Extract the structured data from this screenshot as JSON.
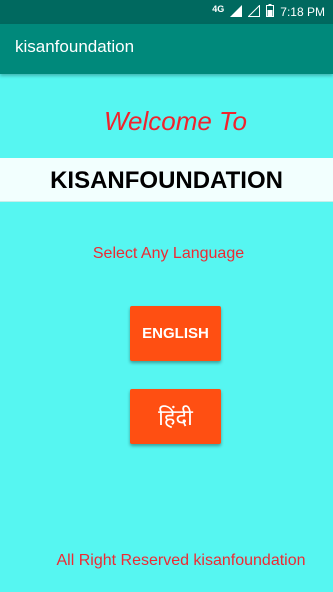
{
  "status_bar": {
    "network": "4G",
    "time": "7:18 PM",
    "icons": [
      "signal-icon",
      "signal-empty-icon",
      "battery-icon"
    ]
  },
  "toolbar": {
    "title": "kisanfoundation"
  },
  "main": {
    "welcome": "Welcome To",
    "banner": "KISANFOUNDATION",
    "select_prompt": "Select Any Language",
    "buttons": {
      "english": "ENGLISH",
      "hindi": "हिंदी"
    }
  },
  "footer": {
    "text": "All Right Reserved kisanfoundation"
  },
  "colors": {
    "background": "#56f6f1",
    "toolbar": "#00897b",
    "status_bar": "#00695f",
    "accent_text": "#ee2a33",
    "button": "#ff4f12"
  }
}
